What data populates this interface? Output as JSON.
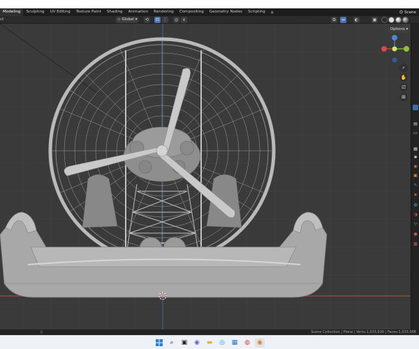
{
  "workspace_tabs": [
    "Modeling",
    "Sculpting",
    "UV Editing",
    "Texture Paint",
    "Shading",
    "Animation",
    "Rendering",
    "Compositing",
    "Geometry Nodes",
    "Scripting"
  ],
  "active_tab_index": 0,
  "add_tab_label": "+",
  "scene": {
    "icon": "scene-icon",
    "label": "Scene"
  },
  "viewport_header": {
    "select_label": "ct",
    "transform_orientation": "Global",
    "options_label": "Options"
  },
  "status_bar": {
    "stats": "Scene Collection | Plane | Verts:1,033,930 | Faces:1,033,006"
  },
  "colors": {
    "viewport_bg": "#3a3a3a",
    "x_axis": "#d24a4a",
    "y_axis": "#8fc23a",
    "z_axis": "#4a86d4",
    "model": "#a9a9a9",
    "taskbar_bg": "#eef1f6"
  },
  "navigation_tools": [
    "zoom-icon",
    "pan-hand-icon",
    "camera-icon",
    "grid-icon"
  ],
  "taskbar_items": [
    "windows-start-icon",
    "search-icon",
    "task-view-icon",
    "chat-icon",
    "file-explorer-icon",
    "edge-icon",
    "store-icon",
    "chrome-icon",
    "blender-icon"
  ]
}
